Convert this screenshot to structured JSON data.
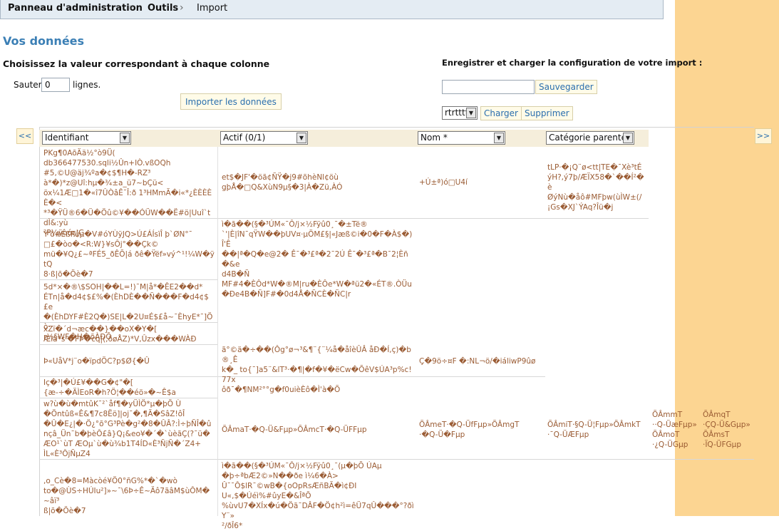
{
  "breadcrumb": {
    "item1": "Panneau d'administration",
    "item2": "Outils",
    "item3": "Import",
    "separator": "›"
  },
  "page": {
    "title": "Vos données",
    "subtitle": "Choisissez la valeur correspondant à chaque colonne",
    "skip_label_before": "Sauter",
    "skip_value": "0",
    "skip_label_after": "lignes.",
    "import_button": "Importer les données"
  },
  "config": {
    "title": "Enregistrer et charger la configuration de votre import :",
    "name_value": "",
    "save_button": "Sauvegarder",
    "selected_config": "rtrtttt",
    "load_button": "Charger",
    "delete_button": "Supprimer"
  },
  "nav": {
    "prev": "<<",
    "next": ">>"
  },
  "columns": [
    {
      "label": "Identifiant"
    },
    {
      "label": "Actif (0/1)"
    },
    {
      "label": "Nom *"
    },
    {
      "label": "Catégorie parente"
    }
  ],
  "cells": {
    "r1c1": "PKg¶0AõÄä½°ò9­Ü(\ndb366477530.sqli½Ûn+IÒ.vßOQh\n#5,©U@äj¾ºa�¢$¶H�-RZ³\nà*�)*z@Uî:hµ�¾±a_ü7~bÇü<\nöx¼1Æ□1�«î7ÛÒâÊ¯Î:ð 1³HMmÃ�i«*¿ÈÈÈÈÈ�<\n*³�ŸÜ®6�Ü�Öû©¥��ÓÜW��Ë#ö|Uuî`tdÌ&:yù\n²P¼ÿòóç|G",
    "r1c2": "et$�JF'�öã¢ÑŸ�j9#õhèNl¢öù\ngþÅ�□Q&XùN9µ§�3|À�Zü,ÀÓ",
    "r1c3": "+Ú±ª)ó□U4í",
    "r1c4": "tLP·�¡Q¨ø<tt|TE�¯Xè³tÉ\nýH?,ý7þ/ÆÏX58�`��Í²�è\nØýNù�åô#MFþw(ùÌW±(/\n¡Gs�XJ`ÝAq?Îü�j",
    "r2c1": "Y'ö#ÉßPúµ�V#óYÙÿJQ>Ú£ÁÍsïÎ þ`ØN°¯\n□£�òo�<R:W}¥sÔj°��Çk©\nmü�¥Q¿£~ªFÉ5_ðÊÕ|á ðê�Ÿëf»vý^¹!¼W�ÿtQ\n8·ß|õ�Öè�7",
    "r2c2": "ì�ã��(§�³ÚM«¯Ô/j×½Fÿû0¸¯�±Të®\n`'|È|îN¯qŸW��þUV¤·µÖM£§|«Jæß©i�0�F�À$�)Î'Ê\n��|ª�Q�e@2� Ê¯�³£ª�2¯2Ú Ê¯�³£ª�B¯2¦Èñ�&e\nd4B�Ñ\nMF#4�ÈÔd*W�®M|ru�ÈÔe*W�ªü2�«ÉT®.ÒÜu\n�Ðe4B�Ñ]F#�0d4Å�ÑCÈ�ÑC|r",
    "r3c1": "5d*×�®\\$SOH|��L=!)¯M|å*�ÊE2��d*\nÉTn|å�d4¢$£%�(ÈhDÈ��Ñ���F�d4¢$£e\n�(ÈhDYF#È2Q�)SE|L�2U¤É$£å~¯ÈhyE*¯]Öò·\nr½§WF�H�õÀÐÕ",
    "r4c1": "xZï�´d¬æc��}��oX�Y�[\nÆlä*s'�FÞ�cq|(,ðøÅZ)*V,Ûzx���WÀÐ",
    "r5c1": "Þ«UåV*j¨o�ïpdÖC?p$Ø{�Û",
    "r5c2": "ã°©ä�÷��(Ôg°ø¬³&¶¨{¨¼å�åîèÛÂ åÐ�Í,ç)�b®¸Ê\nk�_ to{¯]a5¨&lT³·�¶|�f�¥�ëCw�ÕêV$ÚA³p%c!77x\nôð¯�¶NM²°°g�f0uièÈô�Ì'à�Õ",
    "r5c3": "Ç�9ö÷¤F �:NL¬ö/�iáliwP9ûø",
    "r6c1": "Iç�³|�Ú£¥��G�¢\"�[\n{æ-÷�ÄÌEoR�h?Ö¦��éö»�~Ê$a",
    "r7c1": "w?ù�ù�mtûK¯²`åf¶�yÜÌÖ*µ�þÕ Ù\n�Öntûß«Ê&¶7c8Ëö]|oj¯�,¶Ã�SâZ!ôÎ\n�Û�E¿|�·Ö¿°õ°G³Pè�g²�8�ÛÂ?:Ì÷þÑÎ�û\nnçâ_Ün¯b�þèÔ£â}Q¡&eo¥�´�`ùèãÇ(?¯ü�\nÆO¹`ùT ÆOµ`ù�ù¾b1T4ÍD«È³ÑjÑ�´Z4+\nÌL«È³ÔjÑµZ4",
    "r7c2": "ÕÂmaT·�Q-Ü&Fµp»ÕÂmcT·�Q-ÜFFµp",
    "r7c3": "ÕÂmeT·�Q-ÜfFµp»ÕÂmgT\n·�Q-Ü�Fµp",
    "r7c4": "ÕÂmiT·§Q-Ü¦Fµp»ÕÂmkT\n·¯Q-ÜÆFµp",
    "r7c5": "ÕÂmmT\n··Q-ÜæFµp»\nÕÂmoT\n·¿Q-ÜGµp",
    "r7c6": "ÕÂmqT\n·ÇQ-Ü&Gµp»\nÕÂmsT\n·ÏQ-ÜFGµp",
    "r8c1": ",o_Cè�8=Màcòé¥Ö0°ñG%*�`�wò\nto�@ÙS÷HÚIu²]»~¯\\6Þ÷Ê~Äô7ãâM$ùÔM�~âï³\nß|õ�Öè�7",
    "r8c2": "ì�ã��(§�³ÚM«¯Ô/j×½Fÿû0¸¯(µ�þÕ ÚAµ\n�þ÷ªbÆ2©»N��ðe ì¼6�À>\nÛ¯¯Ô$lR¯©wB�{oOpRsÆñBÃ�ì¢ÐI\nU«,$�Úéì%#ûyE�&ÎªÕ\n%ùvU7�XÍx�ú�Öã¯DÂF�Ö¢h²ì=êÜ7qÛ���°?ðìY¨»\n²/ðÎ6*"
  }
}
